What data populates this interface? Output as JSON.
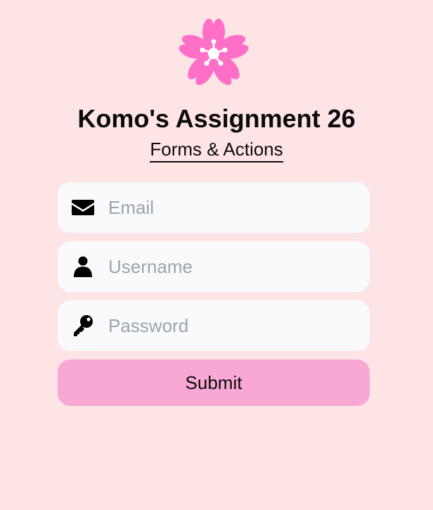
{
  "logo": {
    "icon": "sakura-flower-icon",
    "color": "#FF6EC7"
  },
  "header": {
    "title": "Komo's Assignment 26",
    "subtitle": "Forms & Actions"
  },
  "form": {
    "email": {
      "placeholder": "Email",
      "value": "",
      "icon": "envelope-icon"
    },
    "username": {
      "placeholder": "Username",
      "value": "",
      "icon": "user-icon"
    },
    "password": {
      "placeholder": "Password",
      "value": "",
      "icon": "key-icon"
    },
    "submit_label": "Submit"
  },
  "colors": {
    "background": "#FFE4E6",
    "field_background": "#F8FAFC",
    "button": "#F9A8D4",
    "placeholder": "#9CA3AF"
  }
}
